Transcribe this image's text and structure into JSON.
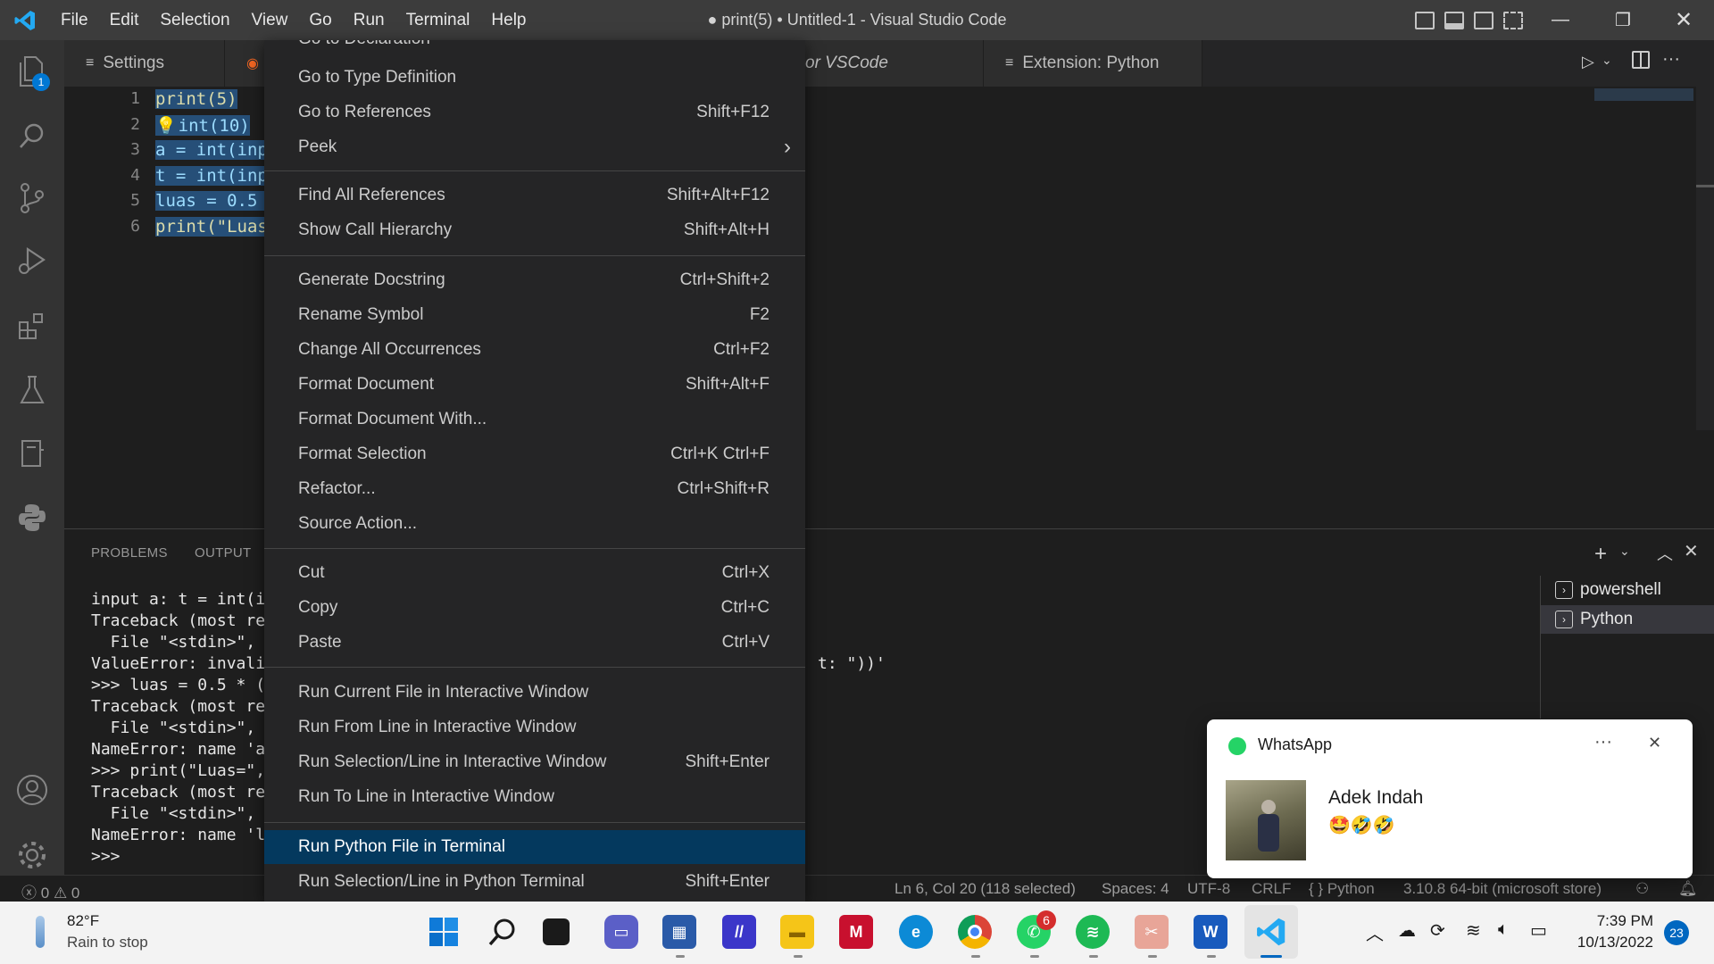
{
  "titlebar": {
    "menus": [
      "File",
      "Edit",
      "Selection",
      "View",
      "Go",
      "Run",
      "Terminal",
      "Help"
    ],
    "window_title": "● print(5) • Untitled-1 - Visual Studio Code"
  },
  "activity": {
    "explorer_badge": "1"
  },
  "tabs": {
    "settings": "Settings",
    "partial": "or VSCode",
    "extension_python": "Extension: Python"
  },
  "editor": {
    "line_numbers": [
      "1",
      "2",
      "3",
      "4",
      "5",
      "6"
    ],
    "lines": [
      "print(5)",
      "int(10)",
      "a = int(inp",
      "t = int(inp",
      "luas = 0.5 ",
      "print(\"Luas"
    ]
  },
  "panel": {
    "tabs": [
      "PROBLEMS",
      "OUTPUT"
    ],
    "terminal_lines": [
      "input a: t = int(i",
      "Traceback (most re",
      "  File \"<stdin>\",",
      "ValueError: invali",
      ">>> luas = 0.5 * (",
      "Traceback (most re",
      "  File \"<stdin>\",",
      "NameError: name 'a",
      ">>> print(\"Luas=\",",
      "Traceback (most re",
      "  File \"<stdin>\",",
      "NameError: name 'l",
      ">>>"
    ],
    "terminal_fragment": "t: \"))'",
    "terminals": [
      "powershell",
      "Python"
    ]
  },
  "context_menu": {
    "partial_top": "Go to Declaration",
    "groups": [
      [
        {
          "label": "Go to Type Definition",
          "key": ""
        },
        {
          "label": "Go to References",
          "key": "Shift+F12"
        },
        {
          "label": "Peek",
          "key": "›"
        }
      ],
      [
        {
          "label": "Find All References",
          "key": "Shift+Alt+F12"
        },
        {
          "label": "Show Call Hierarchy",
          "key": "Shift+Alt+H"
        }
      ],
      [
        {
          "label": "Generate Docstring",
          "key": "Ctrl+Shift+2"
        },
        {
          "label": "Rename Symbol",
          "key": "F2"
        },
        {
          "label": "Change All Occurrences",
          "key": "Ctrl+F2"
        },
        {
          "label": "Format Document",
          "key": "Shift+Alt+F"
        },
        {
          "label": "Format Document With...",
          "key": ""
        },
        {
          "label": "Format Selection",
          "key": "Ctrl+K Ctrl+F"
        },
        {
          "label": "Refactor...",
          "key": "Ctrl+Shift+R"
        },
        {
          "label": "Source Action...",
          "key": ""
        }
      ],
      [
        {
          "label": "Cut",
          "key": "Ctrl+X"
        },
        {
          "label": "Copy",
          "key": "Ctrl+C"
        },
        {
          "label": "Paste",
          "key": "Ctrl+V"
        }
      ],
      [
        {
          "label": "Run Current File in Interactive Window",
          "key": ""
        },
        {
          "label": "Run From Line in Interactive Window",
          "key": ""
        },
        {
          "label": "Run Selection/Line in Interactive Window",
          "key": "Shift+Enter"
        },
        {
          "label": "Run To Line in Interactive Window",
          "key": ""
        }
      ],
      [
        {
          "label": "Run Python File in Terminal",
          "key": ""
        },
        {
          "label": "Run Selection/Line in Python Terminal",
          "key": "Shift+Enter"
        }
      ]
    ],
    "highlighted": "Run Python File in Terminal"
  },
  "statusbar": {
    "errors": "0",
    "warnings": "0",
    "position": "Ln 6, Col 20 (118 selected)",
    "spaces": "Spaces: 4",
    "encoding": "UTF-8",
    "eol": "CRLF",
    "language": "Python",
    "interpreter": "3.10.8 64-bit (microsoft store)"
  },
  "notification": {
    "app": "WhatsApp",
    "sender": "Adek Indah",
    "message": "🤩🤣🤣",
    "more": "···",
    "close": "✕"
  },
  "taskbar": {
    "weather_temp": "82°F",
    "weather_desc": "Rain to stop",
    "whatsapp_badge": "6",
    "time": "7:39 PM",
    "date": "10/13/2022",
    "notif_count": "23"
  },
  "colors": {
    "accent": "#0078d4",
    "menu_highlight": "#04395e",
    "whatsapp": "#25d366"
  }
}
